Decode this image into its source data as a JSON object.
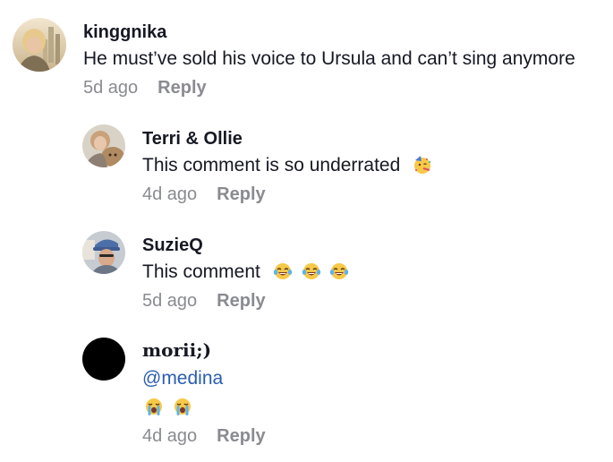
{
  "comments": [
    {
      "username": "kinggnika",
      "text": "He must’ve sold his voice to Ursula and can’t sing anymore",
      "time": "5d ago",
      "reply_label": "Reply",
      "avatar_icon": "profile-photo-blonde-city"
    },
    {
      "username": "Terri & Ollie",
      "text": "This comment is so underrated",
      "emojis": [
        "partying-face-emoji"
      ],
      "time": "4d ago",
      "reply_label": "Reply",
      "avatar_icon": "profile-photo-woman-dog"
    },
    {
      "username": "SuzieQ",
      "text": "This comment",
      "emojis": [
        "tears-of-joy-emoji",
        "tears-of-joy-emoji",
        "tears-of-joy-emoji"
      ],
      "time": "5d ago",
      "reply_label": "Reply",
      "avatar_icon": "profile-photo-woman-cap"
    },
    {
      "username": "morii;)",
      "mention": "@medina",
      "emojis": [
        "loudly-crying-emoji",
        "loudly-crying-emoji"
      ],
      "time": "4d ago",
      "reply_label": "Reply",
      "avatar_icon": "black-avatar"
    }
  ],
  "colors": {
    "text": "#161823",
    "meta": "#8a8b91",
    "mention": "#2b5db0"
  }
}
